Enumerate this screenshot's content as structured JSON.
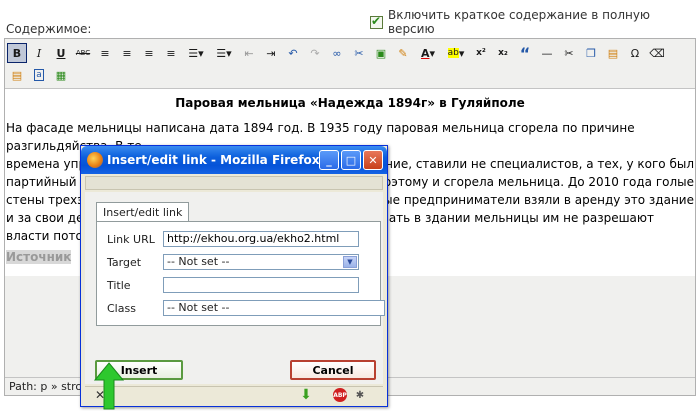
{
  "page": {
    "include_summary_label": "Включить краткое содержание в полную версию",
    "include_summary_checked": true,
    "content_label": "Содержимое:"
  },
  "toolbar": {
    "row1": [
      {
        "icon": "bold-icon",
        "glyph": "B"
      },
      {
        "icon": "italic-icon",
        "glyph": "I"
      },
      {
        "icon": "underline-icon",
        "glyph": "U"
      },
      {
        "icon": "strikethrough-icon",
        "glyph": "ABC"
      },
      {
        "icon": "align-left-icon",
        "glyph": "≡"
      },
      {
        "icon": "align-center-icon",
        "glyph": "≡"
      },
      {
        "icon": "align-right-icon",
        "glyph": "≡"
      },
      {
        "icon": "align-justify-icon",
        "glyph": "≡"
      },
      {
        "icon": "bullet-list-icon",
        "glyph": "☰"
      },
      {
        "icon": "numbered-list-icon",
        "glyph": "☰"
      },
      {
        "icon": "outdent-icon",
        "glyph": "⇤"
      },
      {
        "icon": "indent-icon",
        "glyph": "⇥"
      },
      {
        "icon": "undo-icon",
        "glyph": "↶"
      },
      {
        "icon": "redo-icon",
        "glyph": "↷"
      },
      {
        "icon": "link-icon",
        "glyph": "∞"
      },
      {
        "icon": "unlink-icon",
        "glyph": "✂"
      },
      {
        "icon": "image-icon",
        "glyph": "▣"
      },
      {
        "icon": "cleanup-icon",
        "glyph": "✎"
      },
      {
        "icon": "text-color-icon",
        "glyph": "A"
      },
      {
        "icon": "background-color-icon",
        "glyph": "ab"
      },
      {
        "icon": "superscript-icon",
        "glyph": "x²"
      },
      {
        "icon": "subscript-icon",
        "glyph": "x₂"
      },
      {
        "icon": "blockquote-icon",
        "glyph": "“"
      },
      {
        "icon": "horizontal-rule-icon",
        "glyph": "—"
      },
      {
        "icon": "cut-icon",
        "glyph": "✂"
      },
      {
        "icon": "copy-icon",
        "glyph": "❐"
      },
      {
        "icon": "paste-icon",
        "glyph": "📋"
      },
      {
        "icon": "special-char-icon",
        "glyph": "Ω"
      },
      {
        "icon": "remove-format-icon",
        "glyph": "⌫"
      }
    ],
    "row2": [
      {
        "icon": "paste-word-icon",
        "glyph": "W"
      },
      {
        "icon": "paste-text-icon",
        "glyph": "a"
      },
      {
        "icon": "media-icon",
        "glyph": "▦"
      }
    ]
  },
  "document": {
    "title": "Паровая мельница «Надежда 1894г» в Гуляйполе",
    "paragraph": "На фасаде мельницы написана дата 1894 год. В 1935 году паровая мельница сгорела по причине разгильдяйства. В те времена упра                                                    ование, ставили не специалистов, а тех, у кого был партийный би                                          Поэтому и сгорела мельница. До 2010 года голые стены трехэта                                               естные предприниматели взяли в аренду это здание и за свои ден                                            вировать в здании мельницы им не разрешают власти потом",
    "lines": [
      "На фасаде мельницы написана дата 1894 год. В 1935 году паровая мельница сгорела по причине разгильдяйства. В те",
      "времена упра",
      "ование, ставили не специалистов, а тех, у кого был",
      "партийный би",
      "Поэтому и сгорела мельница. До 2010 года голые",
      "стены трехэта",
      "естные предприниматели взяли в аренду это здание",
      "и за свои ден",
      "вировать в здании мельницы им не разрешают",
      "власти потом"
    ],
    "source_label": "Источник"
  },
  "statusbar": {
    "path_text": "Path: p » strong"
  },
  "dialog": {
    "window_title": "Insert/edit link - Mozilla Firefox",
    "tab_label": "Insert/edit link",
    "link_url_label": "Link URL",
    "link_url_value": "http://ekhou.org.ua/ekho2.html",
    "target_label": "Target",
    "target_value": "-- Not set --",
    "title_label": "Title",
    "title_value": "",
    "class_label": "Class",
    "class_value": "-- Not set --",
    "insert_label": "Insert",
    "cancel_label": "Cancel",
    "close_glyph": "✕"
  },
  "colors": {
    "titlebar": "#0553d8",
    "insert_border": "#5a9a40",
    "cancel_border": "#b84030",
    "arrow": "#2ec82e"
  }
}
